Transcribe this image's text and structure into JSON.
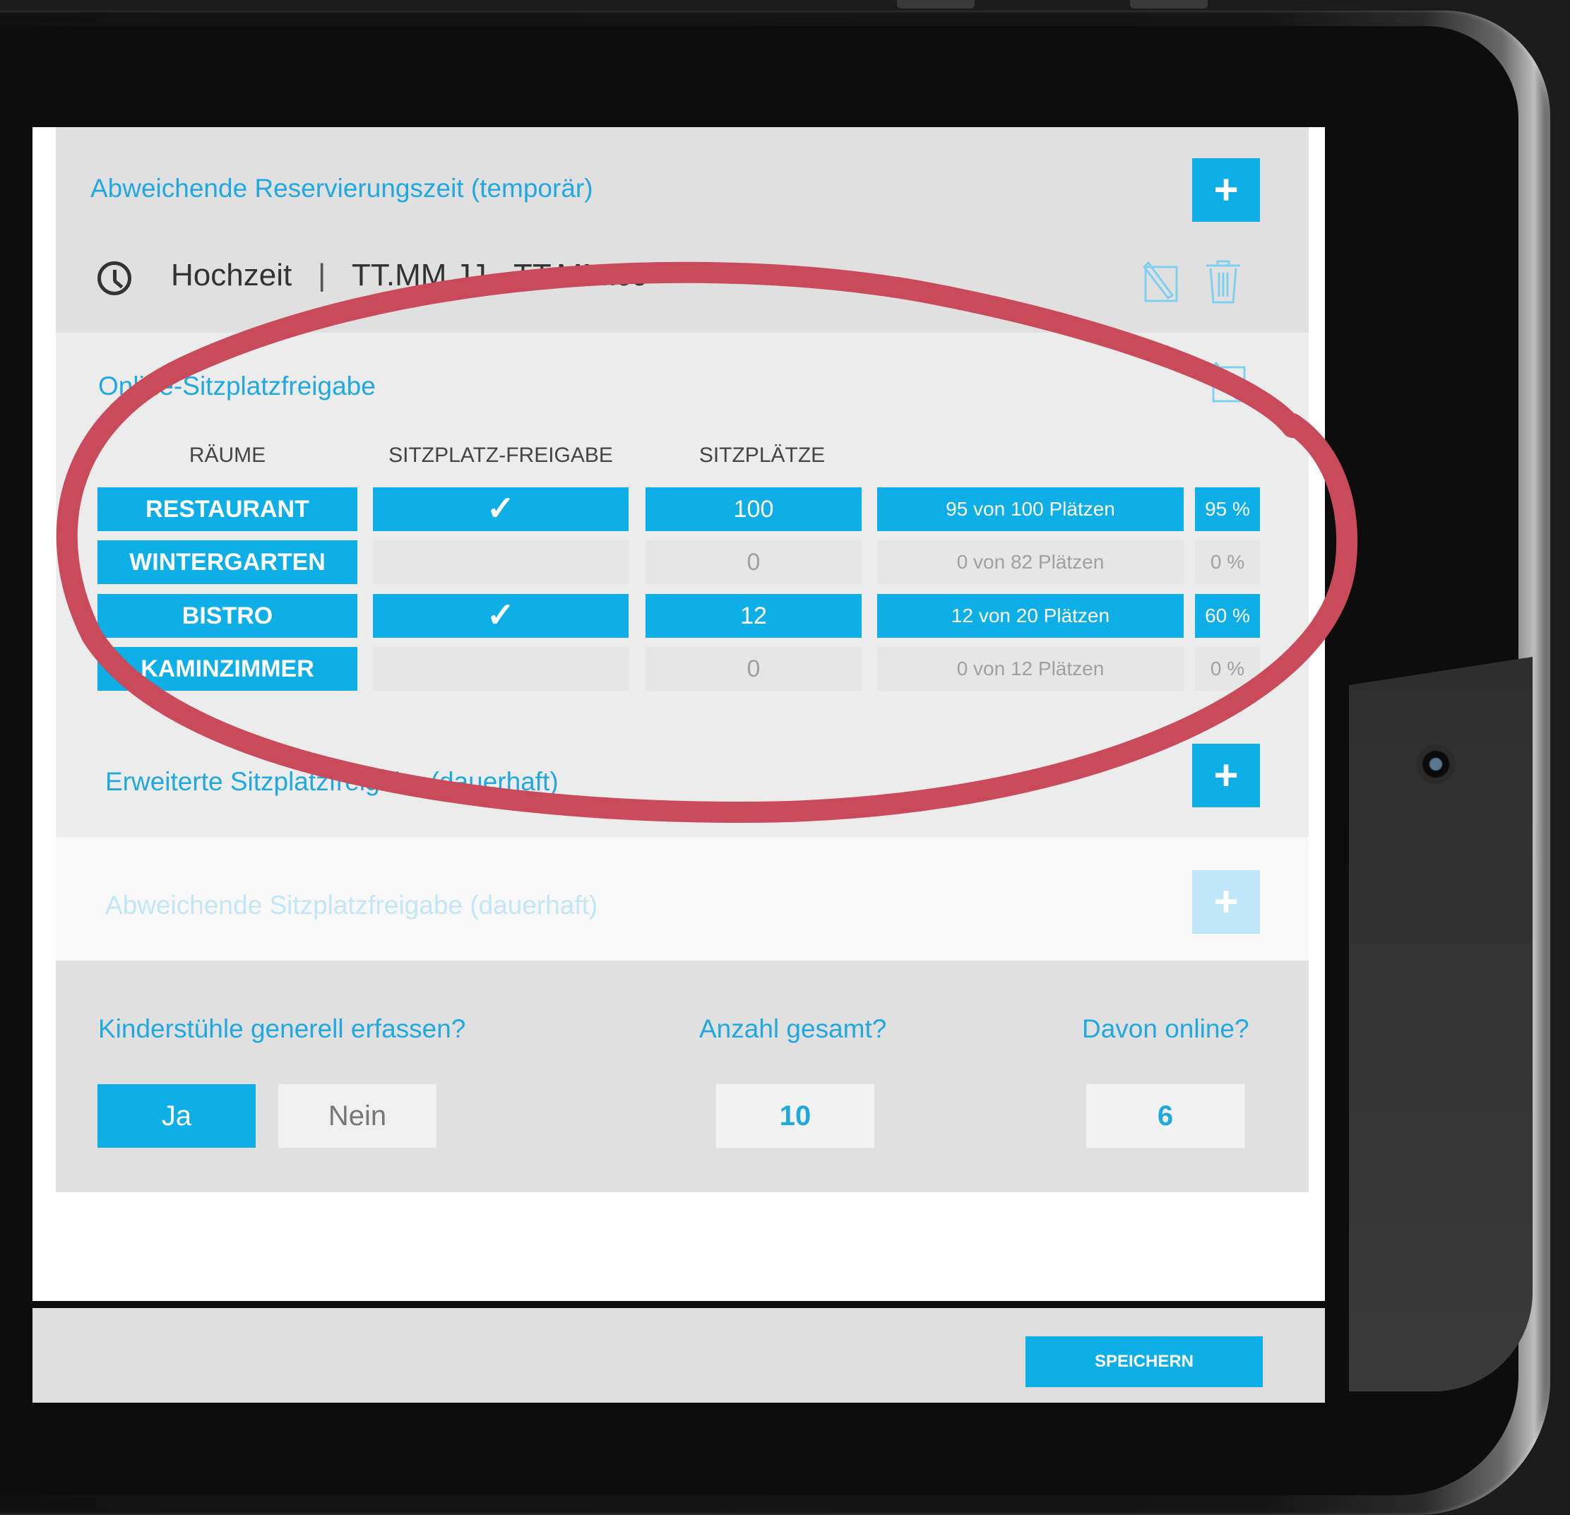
{
  "sections": {
    "temp_reservation_title": "Abweichende Reservierungszeit (temporär)",
    "online_release_title": "Online-Sitzplatzfreigabe",
    "extended_release_title": "Erweiterte Sitzplatzfreigabe (dauerhaft)",
    "deviating_release_title": "Abweichende Sitzplatzfreigabe (dauerhaft)",
    "plus_label": "+"
  },
  "event": {
    "name": "Hochzeit",
    "separator": "|",
    "dates": "TT.MM.JJ - TT.MM.JJ"
  },
  "table": {
    "headers": [
      "RÄUME",
      "SITZPLATZ-FREIGABE",
      "SITZPLÄTZE"
    ],
    "rows": [
      {
        "room": "RESTAURANT",
        "release": "✓",
        "seats": "100",
        "summary": "95 von 100 Plätzen",
        "percent": "95 %",
        "active": true
      },
      {
        "room": "WINTERGARTEN",
        "release": "",
        "seats": "0",
        "summary": "0 von 82 Plätzen",
        "percent": "0 %",
        "active": false
      },
      {
        "room": "BISTRO",
        "release": "✓",
        "seats": "12",
        "summary": "12 von 20 Plätzen",
        "percent": "60 %",
        "active": true
      },
      {
        "room": "KAMINZIMMER",
        "release": "",
        "seats": "0",
        "summary": "0 von 12 Plätzen",
        "percent": "0 %",
        "active": false
      }
    ]
  },
  "children": {
    "question": "Kinderstühle generell erfassen?",
    "yes_label": "Ja",
    "no_label": "Nein",
    "total_label": "Anzahl gesamt?",
    "total_value": "10",
    "online_label": "Davon online?",
    "online_value": "6"
  },
  "footer": {
    "save_label": "SPEICHERN"
  },
  "colors": {
    "accent": "#0eaee6",
    "annotation_ring": "#c94a5a"
  },
  "icons": [
    "clock-icon",
    "edit-icon",
    "trash-icon",
    "plus-icon",
    "check-icon"
  ]
}
